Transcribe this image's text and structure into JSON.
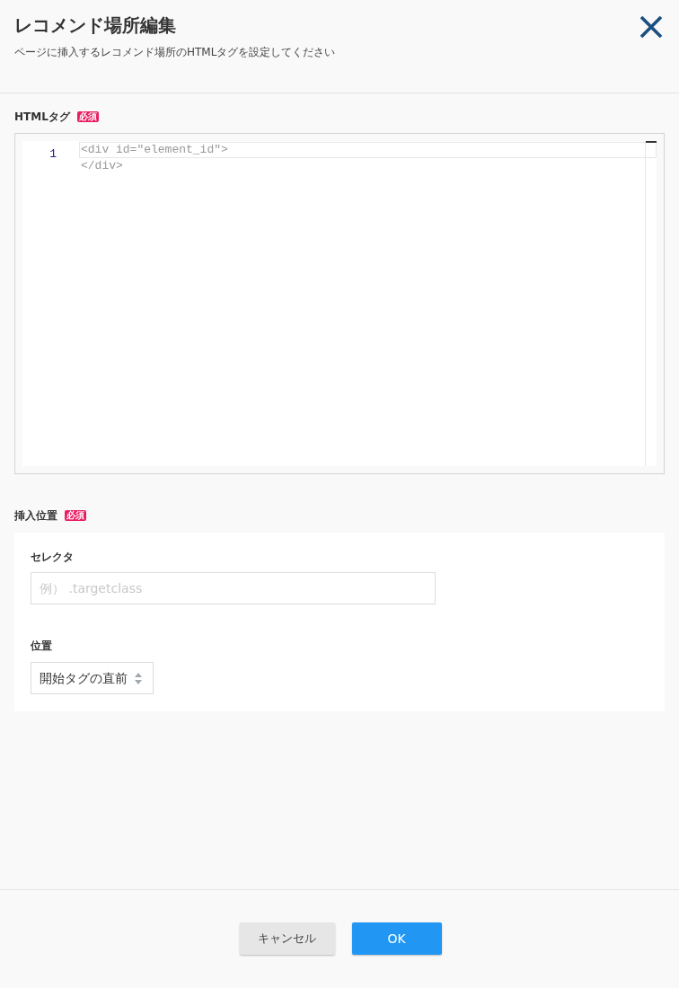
{
  "dialog": {
    "title": "レコメンド場所編集",
    "description": "ページに挿入するレコメンド場所のHTMLタグを設定してください"
  },
  "html_tag": {
    "label": "HTMLタグ",
    "required_badge": "必須",
    "editor": {
      "line_number": "1",
      "placeholder": [
        "<div id=\"element_id\">",
        "</div>"
      ]
    }
  },
  "insert_position": {
    "label": "挿入位置",
    "required_badge": "必須",
    "selector": {
      "label": "セレクタ",
      "placeholder": "例） .targetclass"
    },
    "position": {
      "label": "位置",
      "value": "開始タグの直前"
    }
  },
  "buttons": [
    {
      "label": "キャンセル",
      "kind": "secondary"
    },
    {
      "label": "OK",
      "kind": "primary"
    }
  ]
}
